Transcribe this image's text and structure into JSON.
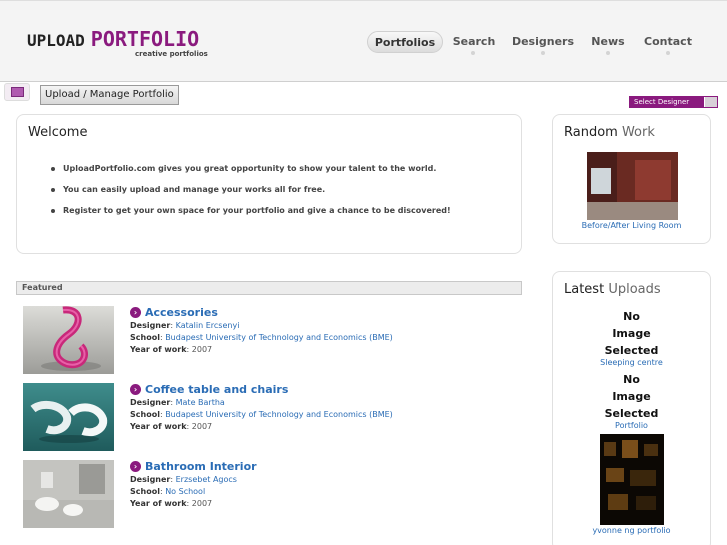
{
  "header": {
    "logo_upload": "UPLOAD",
    "logo_portfolio": "PORTFOLIO",
    "logo_tagline": "creative portfolios",
    "nav": [
      {
        "label": "Portfolios",
        "active": true
      },
      {
        "label": "Search",
        "active": false
      },
      {
        "label": "Designers",
        "active": false
      },
      {
        "label": "News",
        "active": false
      },
      {
        "label": "Contact",
        "active": false
      }
    ]
  },
  "toolbar": {
    "upload_button": "Upload / Manage Portfolio",
    "select_designer": "Select Designer"
  },
  "welcome": {
    "title": "Welcome",
    "bullets": [
      "UploadPortfolio.com gives you great opportunity to show your talent to the world.",
      "You can easily upload and manage your works all for free.",
      "Register to get your own space for your portfolio and give a chance to be discovered!"
    ]
  },
  "featured": {
    "label": "Featured",
    "designer_label": "Designer",
    "school_label": "School",
    "year_label": "Year of work",
    "items": [
      {
        "title": "Accessories",
        "designer": "Katalin Ercsenyi",
        "school": "Budapest University of Technology and Economics (BME)",
        "year": "2007"
      },
      {
        "title": "Coffee table and chairs",
        "designer": "Mate Bartha",
        "school": "Budapest University of Technology and Economics (BME)",
        "year": "2007"
      },
      {
        "title": "Bathroom Interior",
        "designer": "Erzsebet Agocs",
        "school": "No School",
        "year": "2007"
      }
    ]
  },
  "random_work": {
    "title_dark": "Random",
    "title_light": "Work",
    "caption": "Before/After Living Room"
  },
  "latest_uploads": {
    "title_dark": "Latest",
    "title_light": "Uploads",
    "items": [
      {
        "no_image": [
          "No",
          "Image",
          "Selected"
        ],
        "caption": "Sleeping centre"
      },
      {
        "no_image": [
          "No",
          "Image",
          "Selected"
        ],
        "caption": "Portfolio"
      },
      {
        "caption": "yvonne ng portfolio"
      }
    ]
  },
  "colors": {
    "brand_purple": "#8a1a7e",
    "link_blue": "#2a6cb5"
  }
}
